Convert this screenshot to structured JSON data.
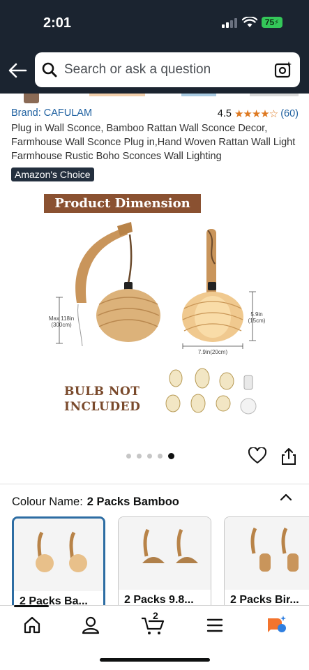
{
  "status_bar": {
    "time": "2:01",
    "battery": "75"
  },
  "search": {
    "placeholder": "Search or ask a question"
  },
  "product": {
    "brand": "Brand: CAFULAM",
    "rating": "4.5",
    "stars": "★★★★☆",
    "rating_count": "(60)",
    "title": "Plug in Wall Sconce, Bamboo Rattan Wall Sconce Decor, Farmhouse Wall Sconce Plug in,Hand Woven Rattan Wall Light Farmhouse Rustic Boho Sconces Wall Lighting",
    "badge": "Amazon's Choice"
  },
  "image": {
    "banner": "Product Dimension",
    "dim_height": "Max 118in (300cm)",
    "dim_shade_height": "5.9in (15cm)",
    "dim_width": "7.9in(20cm)",
    "bulb_note_line1": "BULB NOT",
    "bulb_note_line2": "INCLUDED",
    "carousel_count": 5,
    "carousel_active": 5
  },
  "variation": {
    "label": "Colour Name:",
    "selected": "2 Packs Bamboo",
    "options": [
      {
        "label": "2 Packs Ba..."
      },
      {
        "label": "2 Packs 9.8..."
      },
      {
        "label": "2 Packs Bir..."
      }
    ]
  },
  "bottom_nav": {
    "items": [
      "home-icon",
      "account-icon",
      "cart-icon",
      "menu-icon",
      "rufus-icon"
    ],
    "cart_count": "2"
  },
  "colors": {
    "header": "#1b2430",
    "link": "#2162a1",
    "star": "#de7921",
    "banner": "#8a5131",
    "selected_border": "#2d6da3"
  }
}
